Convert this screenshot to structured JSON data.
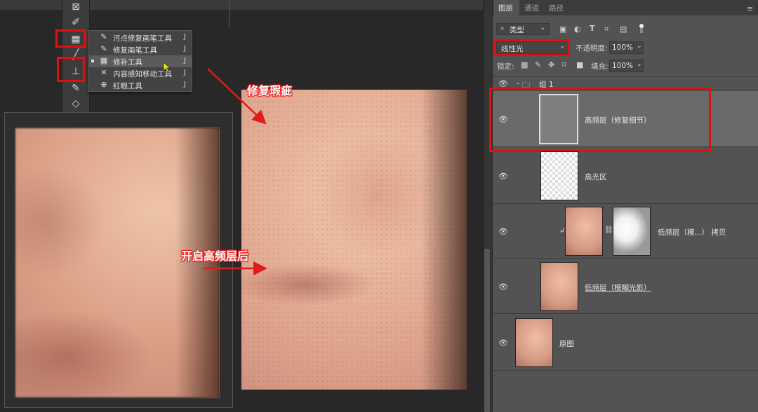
{
  "flyout": {
    "items": [
      {
        "label": "污点修复画笔工具",
        "key": "J",
        "icon": "spot-healing-brush-icon"
      },
      {
        "label": "修复画笔工具",
        "key": "J",
        "icon": "healing-brush-icon"
      },
      {
        "label": "修补工具",
        "key": "J",
        "icon": "patch-tool-icon",
        "selected": true
      },
      {
        "label": "内容感知移动工具",
        "key": "J",
        "icon": "content-aware-move-icon"
      },
      {
        "label": "红眼工具",
        "key": "J",
        "icon": "red-eye-icon"
      }
    ]
  },
  "annotations": {
    "fix_blemish": "修复瑕疵",
    "after_high_freq": "开启高频层后"
  },
  "panel": {
    "tabs": [
      "图层",
      "通道",
      "路径"
    ],
    "filter_kind": "类型",
    "blend_mode": "线性光",
    "opacity_label": "不透明度:",
    "opacity_value": "100%",
    "lock_label": "锁定:",
    "fill_label": "填充:",
    "fill_value": "100%",
    "group_name": "组 1",
    "layers": [
      {
        "name": "高频层（修复细节）"
      },
      {
        "name": "高光区"
      },
      {
        "name": "低频层（模...） 拷贝"
      },
      {
        "name": "低频层（模糊光影）"
      },
      {
        "name": "原图"
      }
    ]
  },
  "colors": {
    "highlight_red": "#e01010",
    "panel_bg": "#535353",
    "canvas_bg": "#282828"
  }
}
